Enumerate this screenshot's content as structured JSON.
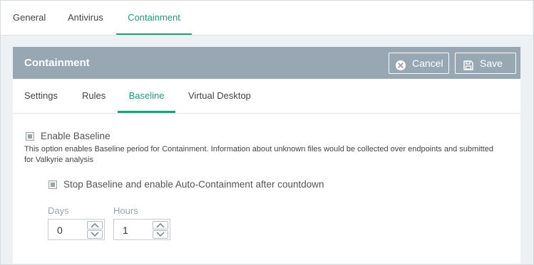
{
  "top_tabs": [
    {
      "label": "General"
    },
    {
      "label": "Antivirus"
    },
    {
      "label": "Containment",
      "active": true
    }
  ],
  "panel": {
    "title": "Containment",
    "cancel_label": "Cancel",
    "save_label": "Save"
  },
  "sub_tabs": [
    {
      "label": "Settings"
    },
    {
      "label": "Rules"
    },
    {
      "label": "Baseline",
      "active": true
    },
    {
      "label": "Virtual Desktop"
    }
  ],
  "baseline": {
    "enable_label": "Enable Baseline",
    "description_line1": "This option enables Baseline period for Containment. Information about unknown files would be collected over endpoints and submitted",
    "description_line2": "for Valkyrie analysis",
    "stop_label": "Stop Baseline and enable Auto-Containment after countdown",
    "days_label": "Days",
    "days_value": "0",
    "hours_label": "Hours",
    "hours_value": "1"
  },
  "icons": {
    "cancel": "close-circle-icon",
    "save": "floppy-disk-icon",
    "up": "chevron-up-icon",
    "down": "chevron-down-icon"
  },
  "colors": {
    "accent": "#1f9e7a",
    "header_bg": "#98a7b4",
    "page_bg": "#eef1f3"
  }
}
